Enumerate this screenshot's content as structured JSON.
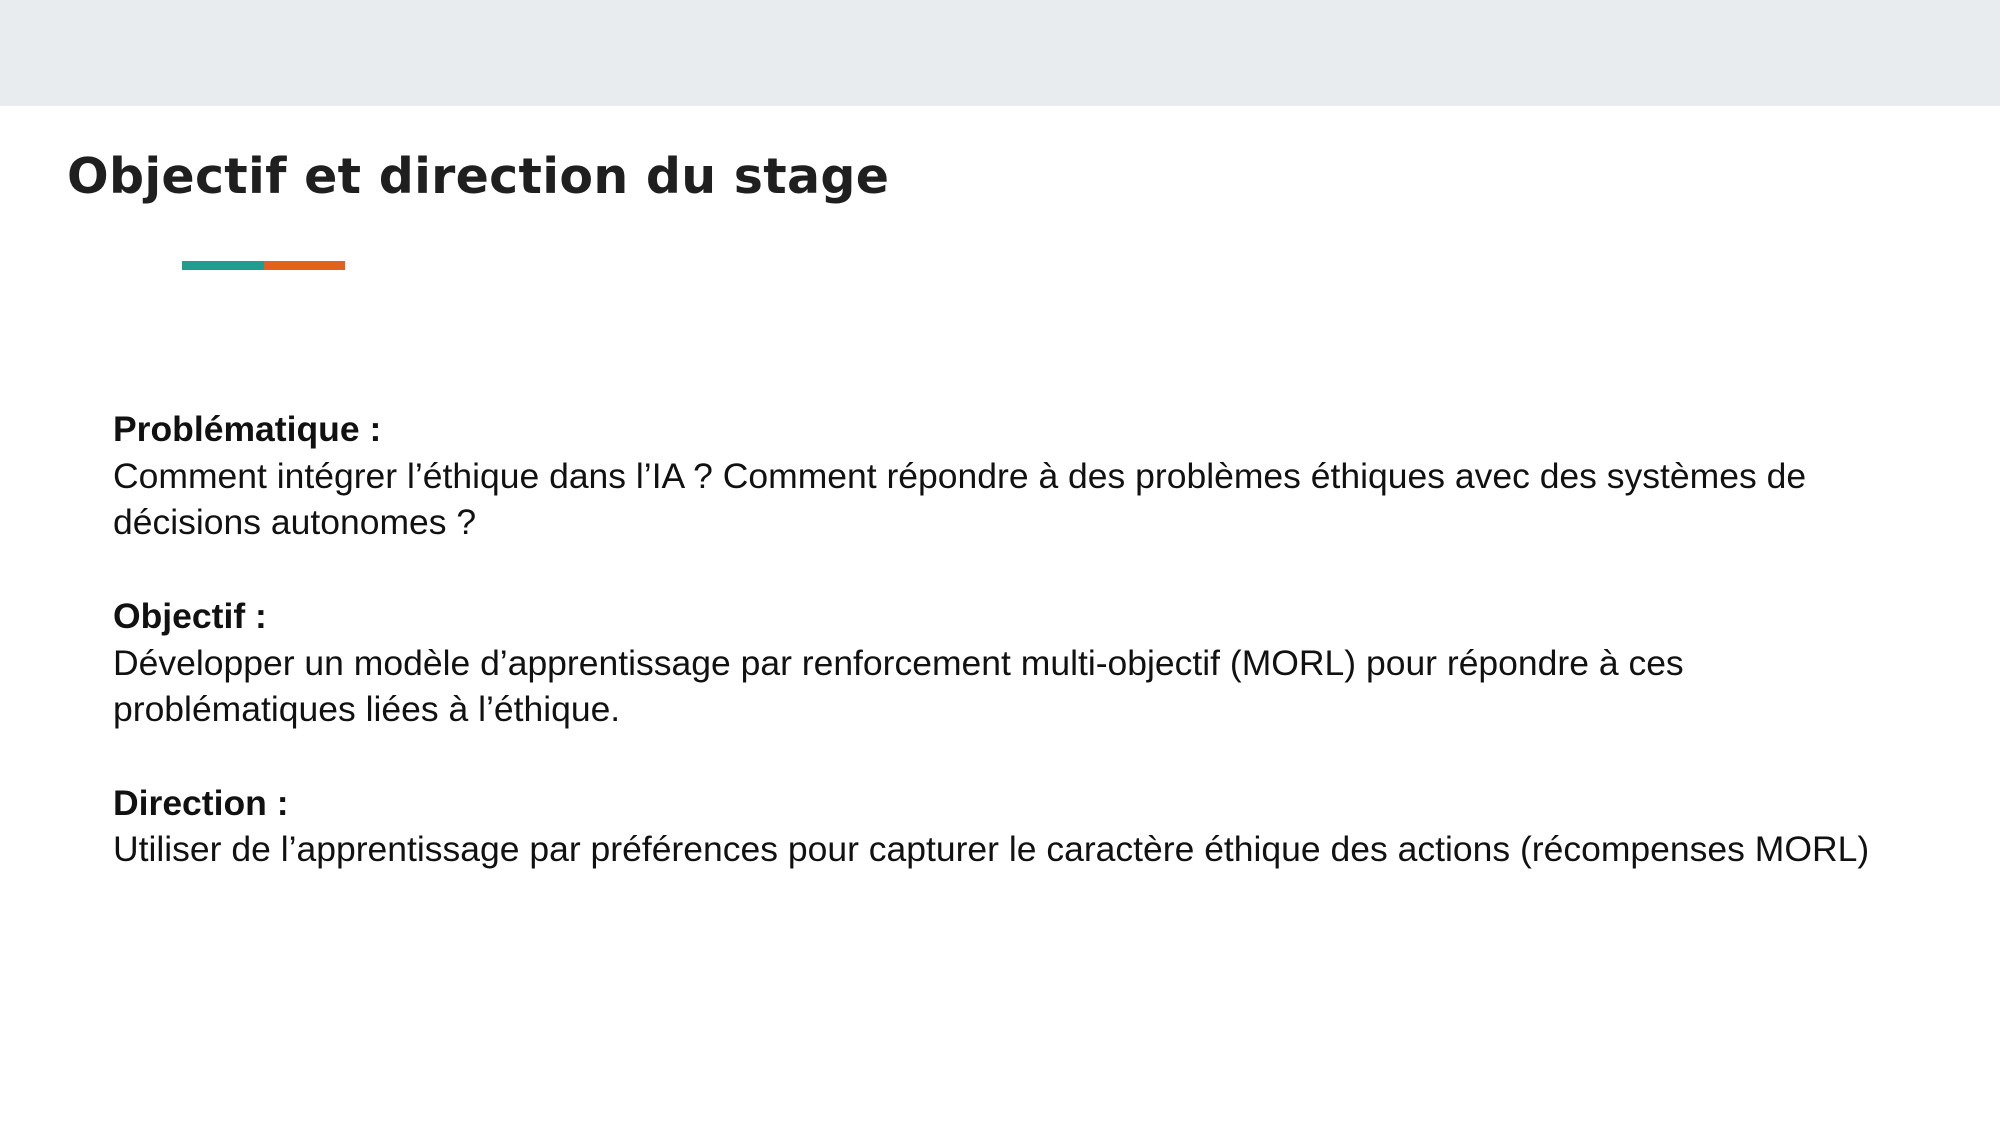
{
  "slide": {
    "title": "Objectif et direction du stage",
    "accent_colors": {
      "teal": "#1f9e8f",
      "orange": "#e3611b"
    },
    "background_band_color": "#e8ecef"
  },
  "sections": [
    {
      "heading": "Problématique :",
      "body": "Comment intégrer l’éthique dans l’IA ? Comment répondre à des problèmes éthiques avec des systèmes de décisions autonomes ?"
    },
    {
      "heading": "Objectif :",
      "body": "Développer un modèle d’apprentissage par renforcement multi-objectif (MORL) pour répondre à ces problématiques liées à l’éthique."
    },
    {
      "heading": "Direction :",
      "body": "Utiliser de l’apprentissage par préférences pour capturer le caractère éthique des actions (récompenses MORL)"
    }
  ]
}
